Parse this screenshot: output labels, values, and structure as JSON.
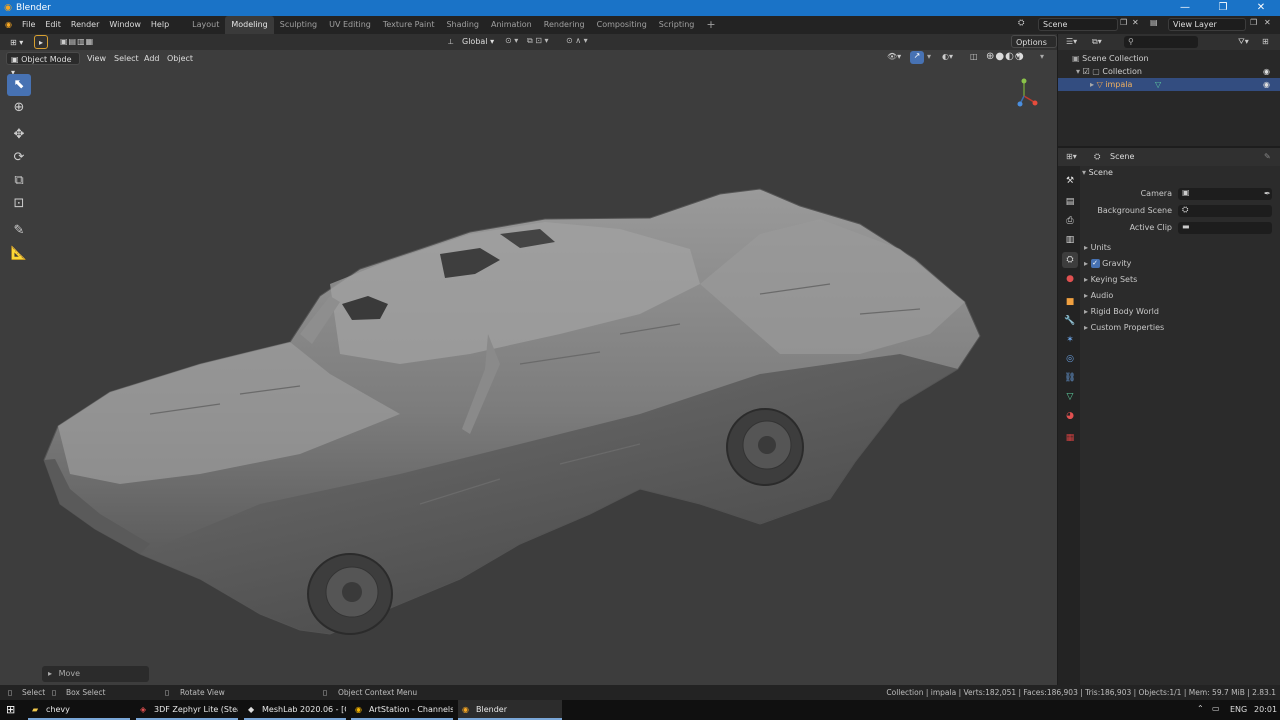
{
  "window": {
    "title": "Blender",
    "controls": [
      "minimize",
      "maximize",
      "close"
    ]
  },
  "menubar": {
    "items": [
      "File",
      "Edit",
      "Render",
      "Window",
      "Help"
    ],
    "workspaces": [
      "Layout",
      "Modeling",
      "Sculpting",
      "UV Editing",
      "Texture Paint",
      "Shading",
      "Animation",
      "Rendering",
      "Compositing",
      "Scripting"
    ],
    "active_workspace": "Modeling",
    "add_workspace": "+",
    "scene": "Scene",
    "view_layer": "View Layer"
  },
  "tool_header": {
    "transform_orientation": "Global",
    "options": "Options"
  },
  "viewport_header": {
    "mode": "Object Mode",
    "menus": [
      "View",
      "Select",
      "Add",
      "Object"
    ]
  },
  "toolbar": {
    "tools": [
      {
        "icon": "select-box-icon",
        "active": true
      },
      {
        "icon": "cursor-icon",
        "active": false
      },
      {
        "icon": "move-icon",
        "active": false
      },
      {
        "icon": "rotate-icon",
        "active": false
      },
      {
        "icon": "scale-icon",
        "active": false
      },
      {
        "icon": "transform-icon",
        "active": false
      },
      {
        "icon": "annotate-icon",
        "active": false
      },
      {
        "icon": "measure-icon",
        "active": false
      }
    ]
  },
  "last_operator": {
    "label": "Move"
  },
  "model": {
    "name": "impala",
    "shading": "solid"
  },
  "outliner": {
    "search_placeholder": "",
    "rows": [
      {
        "label": "Scene Collection",
        "depth": 0
      },
      {
        "label": "Collection",
        "depth": 1
      },
      {
        "label": "impala",
        "depth": 2,
        "selected": true
      }
    ]
  },
  "properties": {
    "context": "Scene",
    "panel": "Scene",
    "fields": [
      {
        "label": "Camera"
      },
      {
        "label": "Background Scene"
      },
      {
        "label": "Active Clip"
      }
    ],
    "sections": [
      {
        "label": "Units",
        "checkbox": false
      },
      {
        "label": "Gravity",
        "checkbox": true,
        "checked": true
      },
      {
        "label": "Keying Sets",
        "checkbox": false
      },
      {
        "label": "Audio",
        "checkbox": false
      },
      {
        "label": "Rigid Body World",
        "checkbox": false
      },
      {
        "label": "Custom Properties",
        "checkbox": false
      }
    ],
    "tab_icons": [
      "tool-icon",
      "render-icon",
      "output-icon",
      "view-layer-icon",
      "scene-icon",
      "world-icon",
      "object-icon",
      "modifier-icon",
      "particles-icon",
      "physics-icon",
      "constraints-icon",
      "data-icon",
      "material-icon",
      "texture-icon"
    ]
  },
  "statusbar": {
    "hints": [
      "Select",
      "Box Select",
      "Rotate View",
      "Object Context Menu"
    ],
    "stats": "Collection | impala | Verts:182,051 | Faces:186,903 | Tris:186,903 | Objects:1/1 | Mem: 59.7 MiB | 2.83.1"
  },
  "taskbar": {
    "items": [
      "chevy",
      "3DF Zephyr Lite (Stea...",
      "MeshLab 2020.06 - [C...",
      "ArtStation - Channels...",
      "Blender"
    ],
    "language": "ENG",
    "time": "20:01"
  },
  "colors": {
    "accent": "#4772b3",
    "selected_row": "#334d80",
    "titlebar": "#1a73c7",
    "viewport": "#3d3d3d"
  }
}
